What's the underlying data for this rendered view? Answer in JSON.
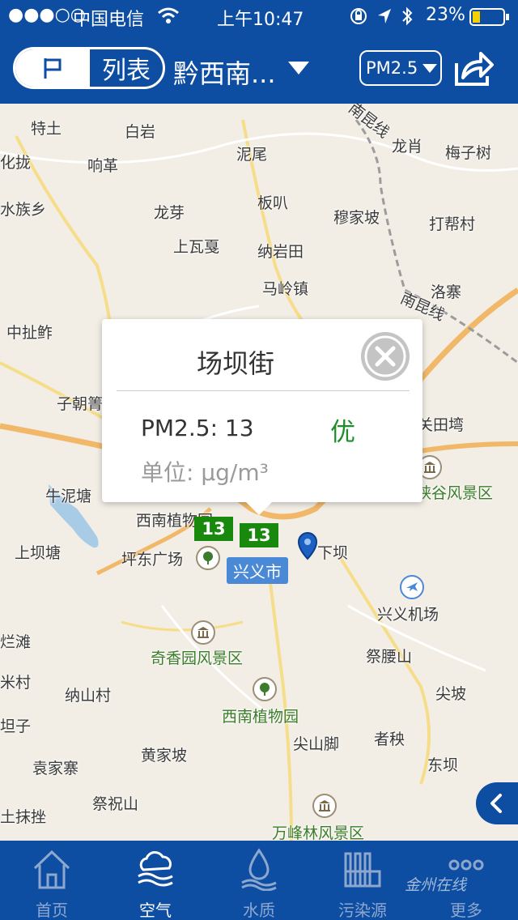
{
  "status_bar": {
    "signal": "●●●○○",
    "carrier": "中国电信",
    "time": "上午10:47",
    "battery": "23%"
  },
  "header": {
    "list_label": "列表",
    "region": "黔西南...",
    "pollutant": "PM2.5"
  },
  "map": {
    "places": [
      {
        "name": "特土",
        "green": false
      },
      {
        "name": "白岩",
        "green": false
      },
      {
        "name": "泥尾",
        "green": false
      },
      {
        "name": "龙肖",
        "green": false
      },
      {
        "name": "梅子树",
        "green": false
      },
      {
        "name": "响革",
        "green": false
      },
      {
        "name": "龙芽",
        "green": false
      },
      {
        "name": "板叭",
        "green": false
      },
      {
        "name": "穆家坡",
        "green": false
      },
      {
        "name": "打帮村",
        "green": false
      },
      {
        "name": "上瓦戛",
        "green": false
      },
      {
        "name": "纳岩田",
        "green": false
      },
      {
        "name": "马岭镇",
        "green": false
      },
      {
        "name": "洛寨",
        "green": false
      },
      {
        "name": "中扯鲊",
        "green": false
      },
      {
        "name": "子朝箐",
        "green": false
      },
      {
        "name": "牛泥塘",
        "green": false
      },
      {
        "name": "西南植物园",
        "green": false
      },
      {
        "name": "上坝塘",
        "green": false
      },
      {
        "name": "坪东广场",
        "green": false
      },
      {
        "name": "下坝",
        "green": false
      },
      {
        "name": "兴义机场",
        "green": false
      },
      {
        "name": "峡谷风景区",
        "green": true
      },
      {
        "name": "关田塆",
        "green": false
      },
      {
        "name": "烂滩",
        "green": false
      },
      {
        "name": "奇香园风景区",
        "green": true
      },
      {
        "name": "祭腰山",
        "green": false
      },
      {
        "name": "米村",
        "green": false
      },
      {
        "name": "纳山村",
        "green": false
      },
      {
        "name": "尖坡",
        "green": false
      },
      {
        "name": "西南植物园",
        "green": true
      },
      {
        "name": "坦子",
        "green": false
      },
      {
        "name": "尖山脚",
        "green": false
      },
      {
        "name": "者秧",
        "green": false
      },
      {
        "name": "袁家寨",
        "green": false
      },
      {
        "name": "黄家坡",
        "green": false
      },
      {
        "name": "东坝",
        "green": false
      },
      {
        "name": "祭祝山",
        "green": false
      },
      {
        "name": "土抹挫",
        "green": false
      },
      {
        "name": "万峰林风景区",
        "green": true
      },
      {
        "name": "水族乡",
        "green": false
      },
      {
        "name": "化拢",
        "green": false
      },
      {
        "name": "南昆线",
        "green": false
      },
      {
        "name": "南昆线",
        "green": false
      }
    ],
    "city": "兴义市",
    "markers": [
      "13",
      "13"
    ]
  },
  "popup": {
    "title": "场坝街",
    "metric": "PM2.5: 13",
    "level": "优",
    "unit": "单位: µg/m³"
  },
  "tabs": [
    {
      "label": "首页",
      "icon": "home-icon"
    },
    {
      "label": "空气",
      "icon": "cloud-icon"
    },
    {
      "label": "水质",
      "icon": "water-drop-icon"
    },
    {
      "label": "污染源",
      "icon": "factory-icon"
    },
    {
      "label": "更多",
      "icon": "more-icon"
    }
  ],
  "watermark": "金州在线",
  "colors": {
    "brand": "#0d4ea3",
    "good": "#18890d",
    "good_text": "#1f8d2b"
  }
}
